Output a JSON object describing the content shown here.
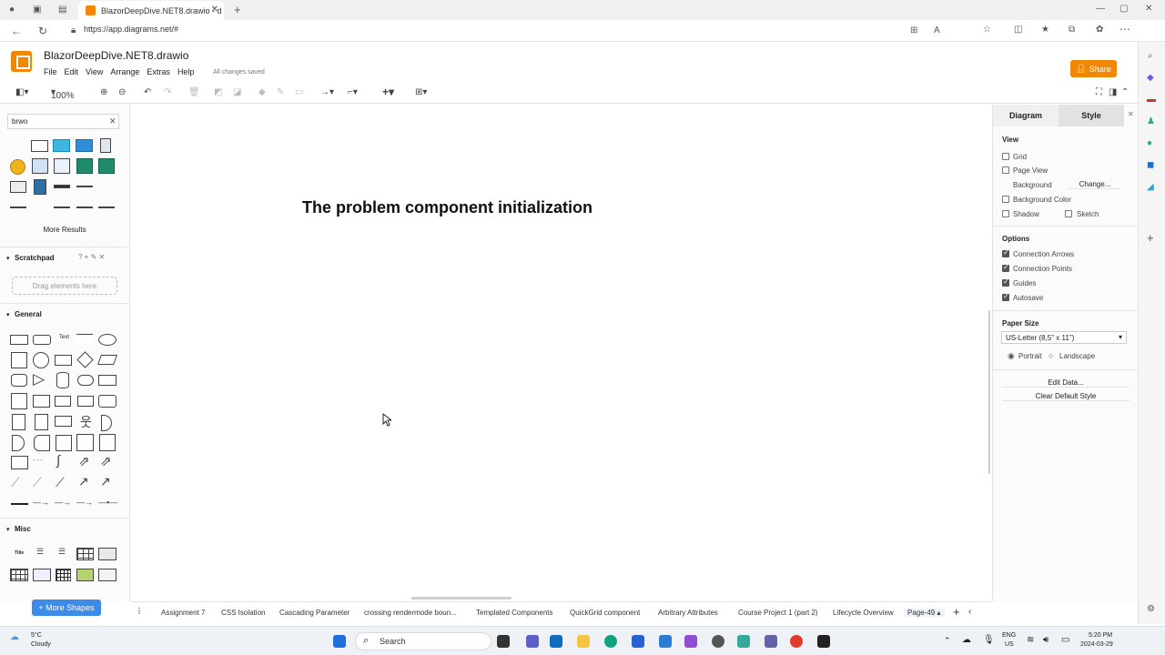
{
  "browser": {
    "tab_title": "BlazorDeepDive.NET8.drawio - d",
    "url": "https://app.diagrams.net/#"
  },
  "app": {
    "doc_title": "BlazorDeepDive.NET8.drawio",
    "menus": [
      "File",
      "Edit",
      "View",
      "Arrange",
      "Extras",
      "Help"
    ],
    "save_status": "All changes saved",
    "share_label": "Share",
    "zoom": "100%"
  },
  "left_panel": {
    "search_value": "brwo",
    "more_results": "More Results",
    "scratchpad_label": "Scratchpad",
    "scratchpad_hint": "Drag elements here",
    "general_label": "General",
    "misc_label": "Misc",
    "more_shapes": "+ More Shapes"
  },
  "canvas": {
    "title": "The problem component initialization"
  },
  "right_panel": {
    "tabs": [
      "Diagram",
      "Style"
    ],
    "view_label": "View",
    "grid": "Grid",
    "page_view": "Page View",
    "background": "Background",
    "change": "Change...",
    "background_color": "Background Color",
    "shadow": "Shadow",
    "sketch": "Sketch",
    "options_label": "Options",
    "connection_arrows": "Connection Arrows",
    "connection_points": "Connection Points",
    "guides": "Guides",
    "autosave": "Autosave",
    "paper_size_label": "Paper Size",
    "paper_size_value": "US-Letter (8,5\" x 11\")",
    "portrait": "Portrait",
    "landscape": "Landscape",
    "edit_data": "Edit Data...",
    "clear_default_style": "Clear Default Style"
  },
  "page_tabs": [
    "Assignment 7",
    "CSS Isolation",
    "Cascading Parameter",
    "crossing rendermode boun...",
    "Templated Components",
    "QuickGrid component",
    "Arbitrary Attributes",
    "Course Project 1 (part 2)",
    "Lifecycle Overview",
    "Page-49"
  ],
  "taskbar": {
    "weather_temp": "5°C",
    "weather_desc": "Cloudy",
    "search_label": "Search",
    "lang1": "ENG",
    "lang2": "US",
    "time": "5:20 PM",
    "date": "2024-03-29"
  }
}
